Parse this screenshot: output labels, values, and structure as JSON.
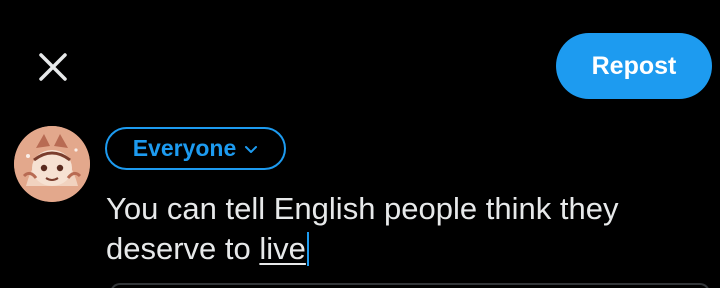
{
  "header": {
    "close_icon": "close-icon",
    "repost_label": "Repost"
  },
  "composer": {
    "avatar_icon": "user-avatar-illustration",
    "audience_label": "Everyone",
    "audience_chevron_icon": "chevron-down-icon",
    "text_before_cursor_word": "You can tell English people think they deserve to ",
    "typed_word": "live"
  },
  "colors": {
    "background": "#000000",
    "accent": "#1d9bf0",
    "text": "#e7e9ea",
    "border": "#333639"
  }
}
